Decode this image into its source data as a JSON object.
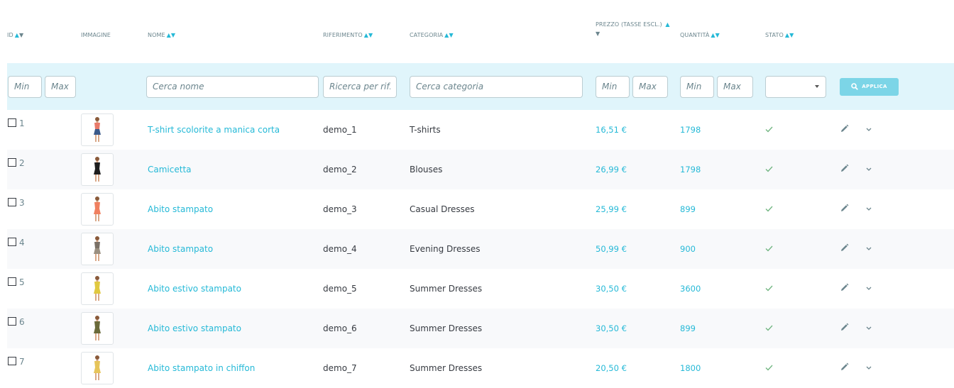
{
  "columns": {
    "id": "ID",
    "image": "IMMAGINE",
    "name": "NOME",
    "reference": "RIFERIMENTO",
    "category": "CATEGORIA",
    "price_line1": "PREZZO (TASSE ESCL.)",
    "quantity": "QUANTITÀ",
    "status": "STATO",
    "sort_up": "▲",
    "sort_down": "▼"
  },
  "filters": {
    "id_min": "Min",
    "id_max": "Max",
    "name": "Cerca nome",
    "reference": "Ricerca per rif.",
    "category": "Cerca categoria",
    "price_min": "Min",
    "price_max": "Max",
    "qty_min": "Min",
    "qty_max": "Max",
    "status_value": "",
    "apply_label": "APPLICA"
  },
  "products": [
    {
      "id": "1",
      "name": "T-shirt scolorite a manica corta",
      "reference": "demo_1",
      "category": "T-shirts",
      "price": "16,51 €",
      "quantity": "1798",
      "active": true,
      "dress_color": "#e87a6a",
      "skirt_color": "#3b5a8a"
    },
    {
      "id": "2",
      "name": "Camicetta",
      "reference": "demo_2",
      "category": "Blouses",
      "price": "26,99 €",
      "quantity": "1798",
      "active": true,
      "dress_color": "#1e1e1e",
      "skirt_color": "#1e1e1e"
    },
    {
      "id": "3",
      "name": "Abito stampato",
      "reference": "demo_3",
      "category": "Casual Dresses",
      "price": "25,99 €",
      "quantity": "899",
      "active": true,
      "dress_color": "#f08060",
      "skirt_color": "#f08060"
    },
    {
      "id": "4",
      "name": "Abito stampato",
      "reference": "demo_4",
      "category": "Evening Dresses",
      "price": "50,99 €",
      "quantity": "900",
      "active": true,
      "dress_color": "#7a7066",
      "skirt_color": "#9a8f80"
    },
    {
      "id": "5",
      "name": "Abito estivo stampato",
      "reference": "demo_5",
      "category": "Summer Dresses",
      "price": "30,50 €",
      "quantity": "3600",
      "active": true,
      "dress_color": "#e0c840",
      "skirt_color": "#e0c840"
    },
    {
      "id": "6",
      "name": "Abito estivo stampato",
      "reference": "demo_6",
      "category": "Summer Dresses",
      "price": "30,50 €",
      "quantity": "899",
      "active": true,
      "dress_color": "#6a6a3a",
      "skirt_color": "#6a6a3a"
    },
    {
      "id": "7",
      "name": "Abito stampato in chiffon",
      "reference": "demo_7",
      "category": "Summer Dresses",
      "price": "20,50 €",
      "quantity": "1800",
      "active": true,
      "dress_color": "#e6c45a",
      "skirt_color": "#e6c45a"
    }
  ],
  "icons": {
    "check": "check-icon",
    "edit": "pencil-icon",
    "more": "chevron-down-icon",
    "search": "search-icon"
  },
  "colors": {
    "link": "#25b9d7",
    "filter_bg": "#e0f5fb",
    "apply_bg": "#7cd5e7",
    "check": "#70b580"
  }
}
